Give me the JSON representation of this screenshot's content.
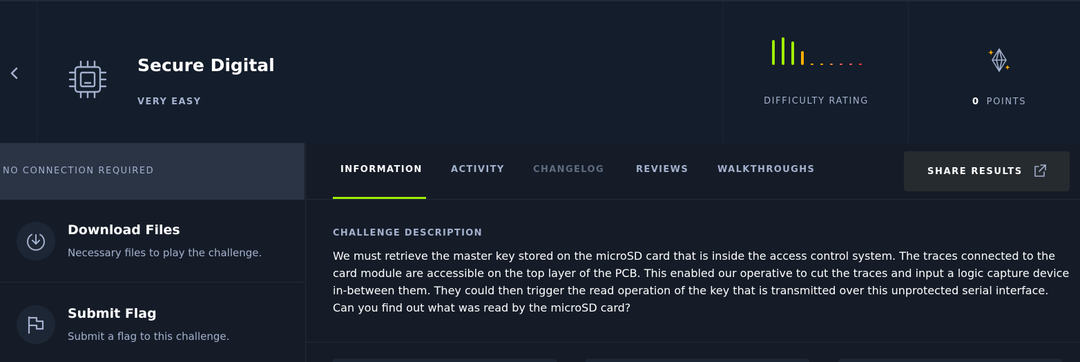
{
  "challenge": {
    "title": "Secure Digital",
    "difficulty": "VERY EASY",
    "category_icon": "chip-icon"
  },
  "rating": {
    "label": "DIFFICULTY RATING",
    "bars": [
      {
        "level": 0.9,
        "color": "#9fef00"
      },
      {
        "level": 1.0,
        "color": "#9fef00"
      },
      {
        "level": 0.85,
        "color": "#9fef00"
      },
      {
        "level": 0.5,
        "color": "#ffaf00"
      },
      {
        "level": 0.15,
        "color": "#ffaf00"
      },
      {
        "level": 0.1,
        "color": "#ffaf00"
      },
      {
        "level": 0.05,
        "color": "#ff8c4a"
      },
      {
        "level": 0.05,
        "color": "#ff5c5c"
      },
      {
        "level": 0.05,
        "color": "#ff5c5c"
      },
      {
        "level": 0.05,
        "color": "#ff3e3e"
      }
    ]
  },
  "points": {
    "value": "0",
    "label": "POINTS",
    "icon": "diamond-icon"
  },
  "sidebar": {
    "connection": "NO CONNECTION REQUIRED",
    "actions": [
      {
        "title": "Download Files",
        "description": "Necessary files to play the challenge.",
        "icon": "download-icon"
      },
      {
        "title": "Submit Flag",
        "description": "Submit a flag to this challenge.",
        "icon": "flag-icon"
      }
    ]
  },
  "tabs": [
    {
      "label": "INFORMATION",
      "state": "active"
    },
    {
      "label": "ACTIVITY",
      "state": "normal"
    },
    {
      "label": "CHANGELOG",
      "state": "disabled"
    },
    {
      "label": "REVIEWS",
      "state": "normal"
    },
    {
      "label": "WALKTHROUGHS",
      "state": "normal"
    }
  ],
  "share": {
    "label": "SHARE RESULTS",
    "icon": "external-link-icon"
  },
  "description": {
    "heading": "CHALLENGE DESCRIPTION",
    "body": "We must retrieve the master key stored on the microSD card that is inside the access control system. The traces connected to the card module are accessible on the top layer of the PCB. This enabled our operative to cut the traces and input a logic capture device in-between them. They could then trigger the read operation of the key that is transmitted over this unprotected serial interface. Can you find out what was read by the microSD card?"
  },
  "colors": {
    "accent": "#9fef00",
    "background": "#151c28",
    "header": "#141d2b",
    "muted_text": "#a4b1cd"
  }
}
